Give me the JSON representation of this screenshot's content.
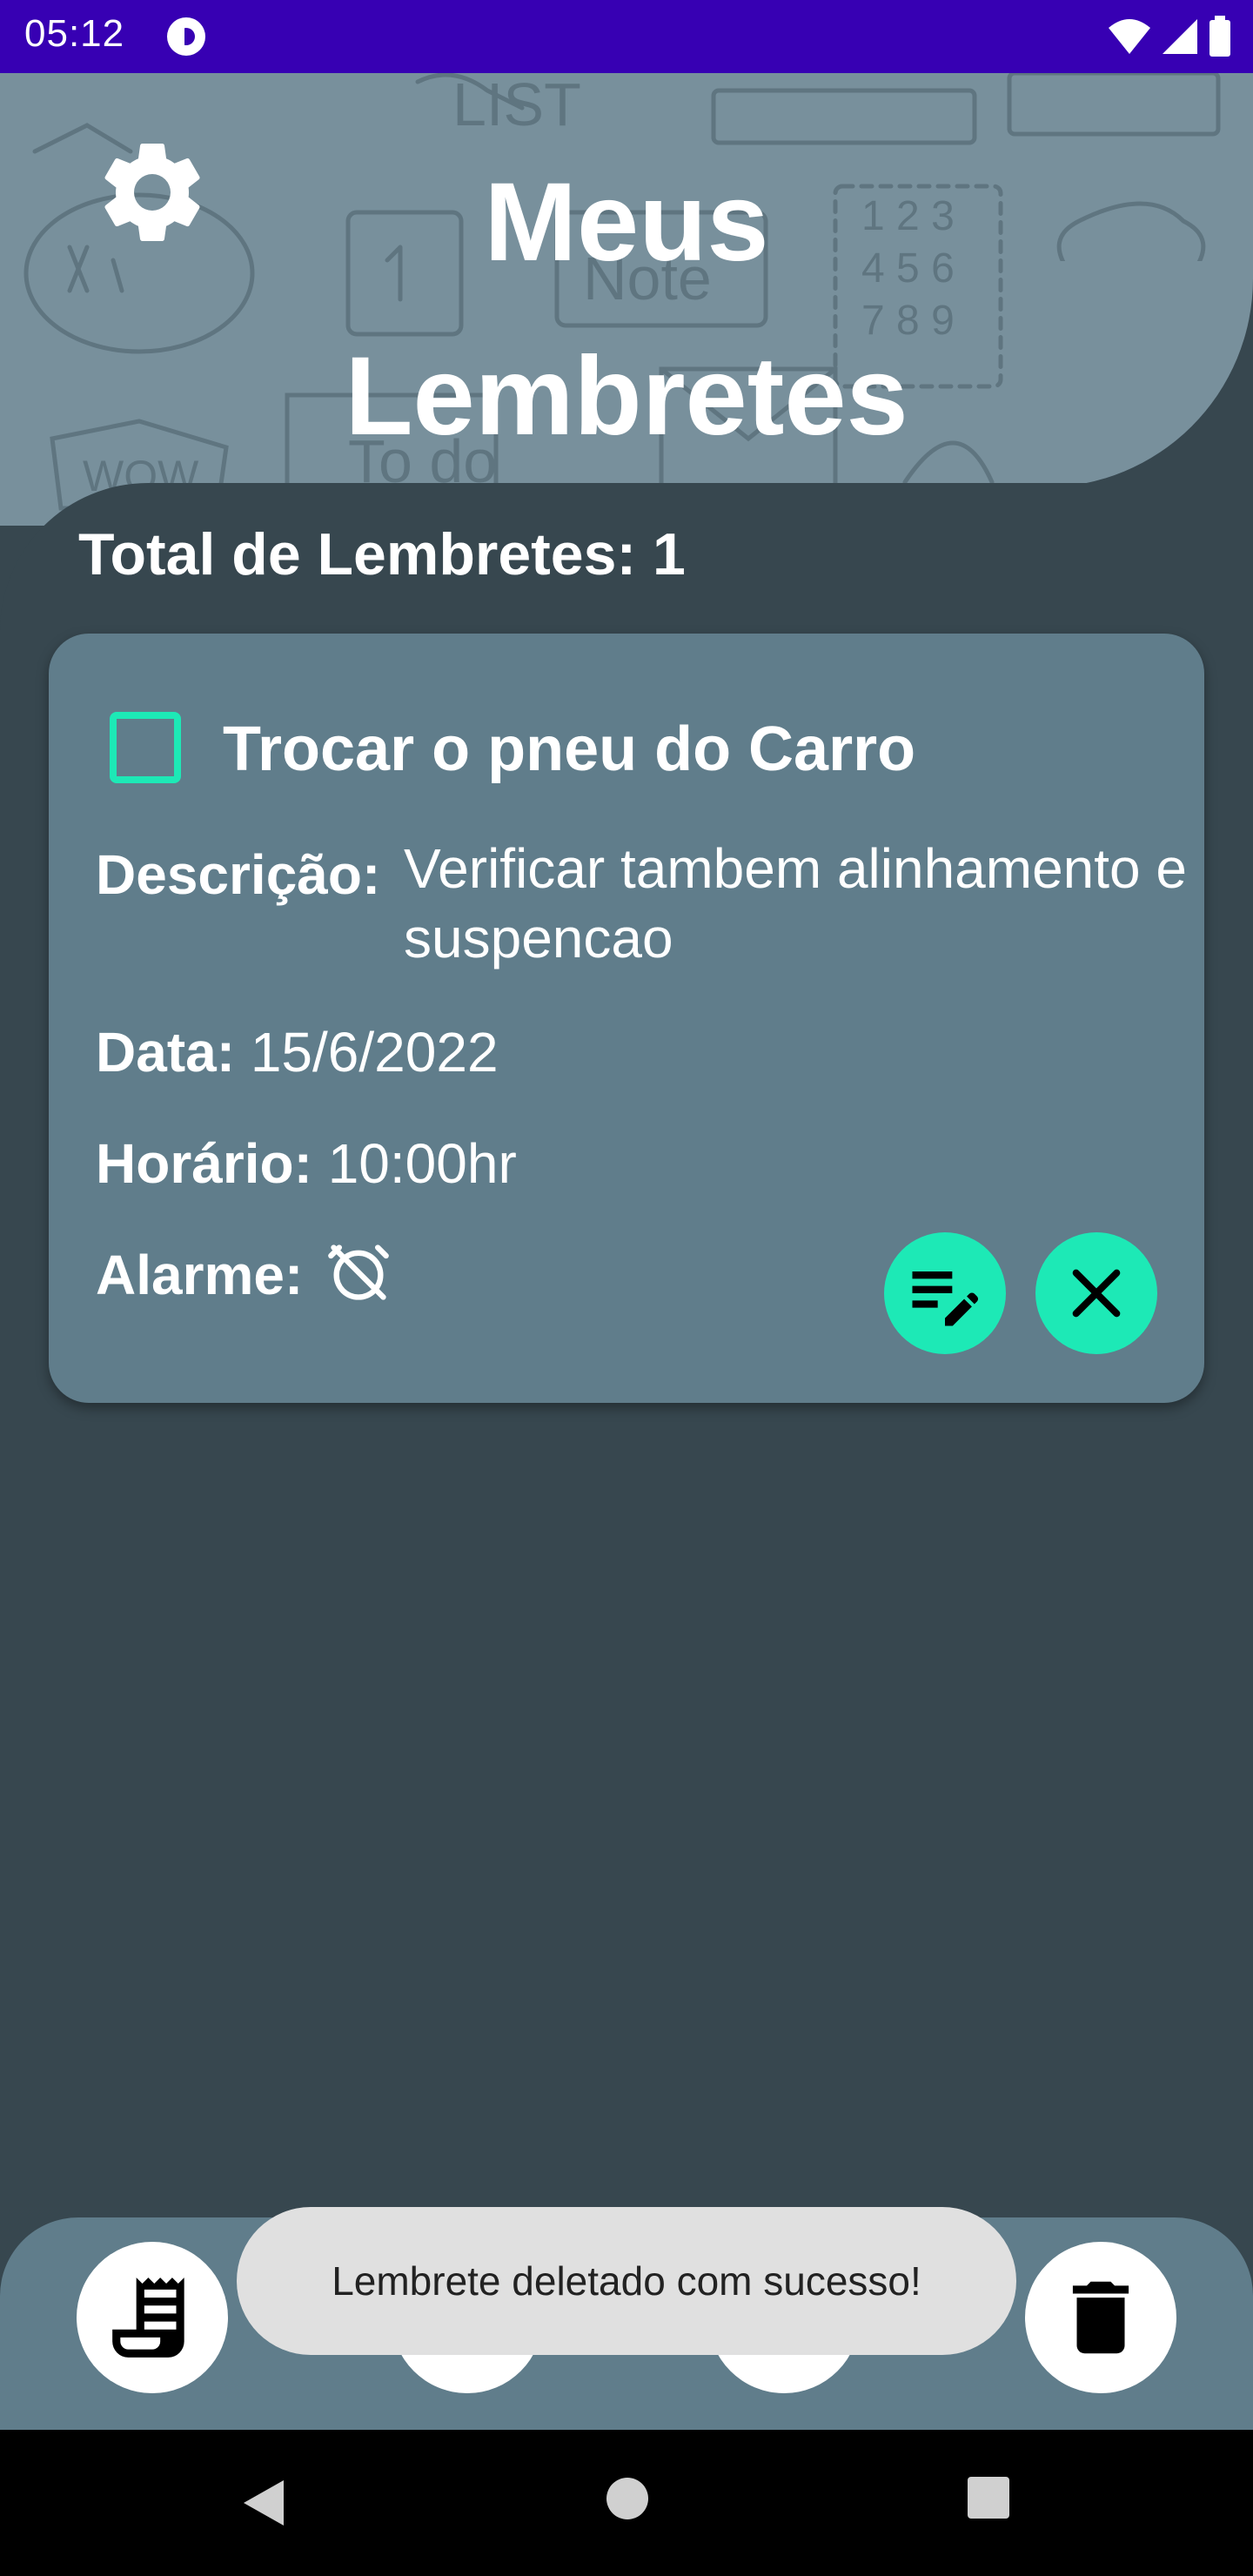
{
  "status_bar": {
    "time": "05:12",
    "icons": [
      "app-notification-icon",
      "wifi-icon",
      "signal-icon",
      "battery-icon"
    ]
  },
  "header": {
    "title_line1": "Meus",
    "title_line2": "Lembretes",
    "settings_icon": "gear-icon"
  },
  "summary": {
    "total_label": "Total de Lembretes: 1"
  },
  "reminders": [
    {
      "title": "Trocar o pneu do Carro",
      "checked": false,
      "description_label": "Descrição:",
      "description_value": "Verificar tambem alinhamento e suspencao",
      "date_label": "Data:",
      "date_value": "15/6/2022",
      "time_label": "Horário:",
      "time_value": "10:00hr",
      "alarm_label": "Alarme:",
      "alarm_icon": "alarm-off-icon",
      "edit_icon": "edit-note-icon",
      "delete_icon": "close-icon"
    }
  ],
  "bottom_nav": {
    "items": [
      "receipt-list-icon",
      "search-icon",
      "add-list-icon",
      "trash-icon"
    ]
  },
  "toast": {
    "message": "Lembrete deletado com sucesso!"
  },
  "system_nav": {
    "items": [
      "back-icon",
      "home-icon",
      "recents-icon"
    ]
  },
  "colors": {
    "status_bar": "#3700b3",
    "background": "#37474f",
    "header": "#78909c",
    "card": "#607d8b",
    "accent": "#1de9b6"
  }
}
